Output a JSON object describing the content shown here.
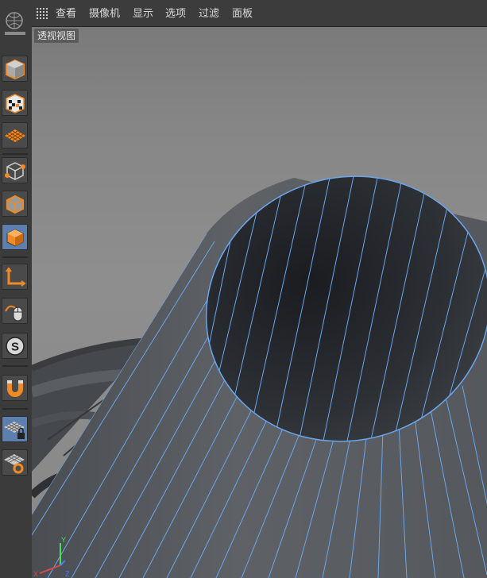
{
  "menu": {
    "items": [
      "查看",
      "摄像机",
      "显示",
      "选项",
      "过滤",
      "面板"
    ]
  },
  "viewport": {
    "label": "透视视图"
  },
  "toolbar": {
    "tools": [
      {
        "name": "cube-mode-icon",
        "active": false
      },
      {
        "name": "checker-cube-icon",
        "active": false
      },
      {
        "name": "grid-plane-icon",
        "active": false
      },
      {
        "name": "point-mode-icon",
        "active": false
      },
      {
        "name": "edge-mode-icon",
        "active": false
      },
      {
        "name": "polygon-mode-icon",
        "active": true
      },
      {
        "name": "axis-icon",
        "active": false
      },
      {
        "name": "mouse-tweak-icon",
        "active": false
      },
      {
        "name": "soft-selection-icon",
        "active": false
      },
      {
        "name": "magnet-snap-icon",
        "active": false
      },
      {
        "name": "grid-lock-icon",
        "active": false
      },
      {
        "name": "workplane-icon",
        "active": false
      }
    ]
  },
  "colors": {
    "wire": "#6aa6ec",
    "active_tool": "#5d7fb0",
    "accent": "#f08a24"
  }
}
